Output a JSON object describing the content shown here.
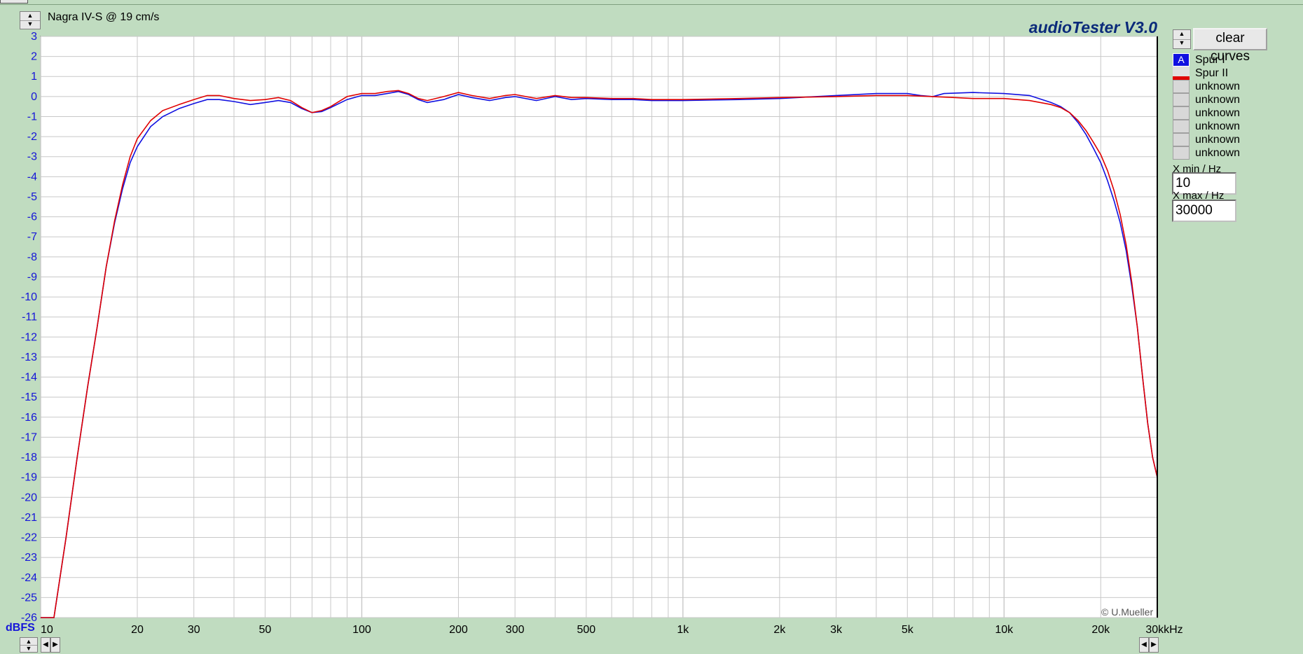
{
  "window": {
    "app_title": "audioTester  V3.0",
    "chart_title": "Nagra IV-S @ 19 cm/s"
  },
  "controls": {
    "clear_label": "clear curves",
    "spin_up": "▲",
    "spin_down": "▼",
    "scroll_left": "◀",
    "scroll_right": "▶"
  },
  "legend": [
    {
      "marker": "A",
      "label": "Spur I",
      "color": "#1010e0"
    },
    {
      "marker": "",
      "label": "Spur II",
      "color": "#e00000"
    },
    {
      "marker": "",
      "label": "unknown"
    },
    {
      "marker": "",
      "label": "unknown"
    },
    {
      "marker": "",
      "label": "unknown"
    },
    {
      "marker": "",
      "label": "unknown"
    },
    {
      "marker": "",
      "label": "unknown"
    },
    {
      "marker": "",
      "label": "unknown"
    }
  ],
  "axis_fields": {
    "xmin_label": "X min / Hz",
    "xmin_value": "10",
    "xmax_label": "X max / Hz",
    "xmax_value": "30000"
  },
  "copyright": "© U.Mueller",
  "colors": {
    "background": "#c0dcc0",
    "plot_background": "#ffffff",
    "grid": "#c8c8c8",
    "axis_text": "#1515d8"
  },
  "chart_data": {
    "type": "line",
    "title": "Nagra IV-S @ 19 cm/s",
    "xscale": "log",
    "xlim": [
      10,
      30000
    ],
    "ylim": [
      -26,
      3
    ],
    "ylabel": "dBFS",
    "xunit": "kHz",
    "grid": true,
    "x_ticks": [
      {
        "value": 10,
        "label": "10"
      },
      {
        "value": 20,
        "label": "20"
      },
      {
        "value": 30,
        "label": "30"
      },
      {
        "value": 50,
        "label": "50"
      },
      {
        "value": 100,
        "label": "100"
      },
      {
        "value": 200,
        "label": "200"
      },
      {
        "value": 300,
        "label": "300"
      },
      {
        "value": 500,
        "label": "500"
      },
      {
        "value": 1000,
        "label": "1k"
      },
      {
        "value": 2000,
        "label": "2k"
      },
      {
        "value": 3000,
        "label": "3k"
      },
      {
        "value": 5000,
        "label": "5k"
      },
      {
        "value": 10000,
        "label": "10k"
      },
      {
        "value": 20000,
        "label": "20k"
      },
      {
        "value": 30000,
        "label": "30k"
      }
    ],
    "y_ticks": [
      3,
      2,
      1,
      0,
      -1,
      -2,
      -3,
      -4,
      -5,
      -6,
      -7,
      -8,
      -9,
      -10,
      -11,
      -12,
      -13,
      -14,
      -15,
      -16,
      -17,
      -18,
      -19,
      -20,
      -21,
      -22,
      -23,
      -24,
      -25,
      -26
    ],
    "series": [
      {
        "name": "Spur I",
        "color": "#1010e0",
        "points": [
          [
            10,
            -26
          ],
          [
            11,
            -26
          ],
          [
            12,
            -22
          ],
          [
            13,
            -18
          ],
          [
            14,
            -14.5
          ],
          [
            15,
            -11.5
          ],
          [
            16,
            -8.5
          ],
          [
            17,
            -6.3
          ],
          [
            18,
            -4.6
          ],
          [
            19,
            -3.3
          ],
          [
            20,
            -2.5
          ],
          [
            22,
            -1.5
          ],
          [
            24,
            -1.0
          ],
          [
            27,
            -0.6
          ],
          [
            30,
            -0.35
          ],
          [
            33,
            -0.15
          ],
          [
            36,
            -0.15
          ],
          [
            40,
            -0.25
          ],
          [
            45,
            -0.4
          ],
          [
            50,
            -0.3
          ],
          [
            55,
            -0.2
          ],
          [
            60,
            -0.3
          ],
          [
            65,
            -0.6
          ],
          [
            70,
            -0.8
          ],
          [
            75,
            -0.75
          ],
          [
            80,
            -0.55
          ],
          [
            90,
            -0.15
          ],
          [
            100,
            0.05
          ],
          [
            110,
            0.05
          ],
          [
            120,
            0.15
          ],
          [
            130,
            0.25
          ],
          [
            140,
            0.1
          ],
          [
            150,
            -0.15
          ],
          [
            160,
            -0.3
          ],
          [
            180,
            -0.15
          ],
          [
            200,
            0.1
          ],
          [
            220,
            -0.05
          ],
          [
            250,
            -0.2
          ],
          [
            280,
            -0.05
          ],
          [
            300,
            0.0
          ],
          [
            350,
            -0.2
          ],
          [
            400,
            0.0
          ],
          [
            450,
            -0.15
          ],
          [
            500,
            -0.1
          ],
          [
            600,
            -0.15
          ],
          [
            700,
            -0.15
          ],
          [
            800,
            -0.2
          ],
          [
            1000,
            -0.2
          ],
          [
            1500,
            -0.15
          ],
          [
            2000,
            -0.1
          ],
          [
            3000,
            0.05
          ],
          [
            4000,
            0.15
          ],
          [
            5000,
            0.15
          ],
          [
            5500,
            0.05
          ],
          [
            6000,
            0.0
          ],
          [
            6500,
            0.15
          ],
          [
            8000,
            0.2
          ],
          [
            10000,
            0.15
          ],
          [
            12000,
            0.05
          ],
          [
            14000,
            -0.3
          ],
          [
            15000,
            -0.5
          ],
          [
            16000,
            -0.8
          ],
          [
            17000,
            -1.3
          ],
          [
            18000,
            -1.9
          ],
          [
            19000,
            -2.6
          ],
          [
            20000,
            -3.3
          ],
          [
            21000,
            -4.2
          ],
          [
            22000,
            -5.2
          ],
          [
            23000,
            -6.3
          ],
          [
            24000,
            -7.7
          ],
          [
            25000,
            -9.5
          ],
          [
            26000,
            -11.5
          ],
          [
            27000,
            -14.0
          ],
          [
            28000,
            -16.3
          ],
          [
            29000,
            -18.0
          ],
          [
            30000,
            -19.0
          ]
        ]
      },
      {
        "name": "Spur II",
        "color": "#e00000",
        "points": [
          [
            10,
            -26
          ],
          [
            11,
            -26
          ],
          [
            12,
            -22
          ],
          [
            13,
            -18
          ],
          [
            14,
            -14.5
          ],
          [
            15,
            -11.5
          ],
          [
            16,
            -8.5
          ],
          [
            17,
            -6.2
          ],
          [
            18,
            -4.4
          ],
          [
            19,
            -3.0
          ],
          [
            20,
            -2.1
          ],
          [
            22,
            -1.2
          ],
          [
            24,
            -0.7
          ],
          [
            27,
            -0.4
          ],
          [
            30,
            -0.15
          ],
          [
            33,
            0.05
          ],
          [
            36,
            0.05
          ],
          [
            40,
            -0.1
          ],
          [
            45,
            -0.2
          ],
          [
            50,
            -0.15
          ],
          [
            55,
            -0.05
          ],
          [
            60,
            -0.2
          ],
          [
            65,
            -0.55
          ],
          [
            70,
            -0.8
          ],
          [
            75,
            -0.7
          ],
          [
            80,
            -0.5
          ],
          [
            90,
            0.0
          ],
          [
            100,
            0.15
          ],
          [
            110,
            0.15
          ],
          [
            120,
            0.25
          ],
          [
            130,
            0.3
          ],
          [
            140,
            0.15
          ],
          [
            150,
            -0.1
          ],
          [
            160,
            -0.2
          ],
          [
            180,
            0.0
          ],
          [
            200,
            0.2
          ],
          [
            220,
            0.05
          ],
          [
            250,
            -0.1
          ],
          [
            280,
            0.05
          ],
          [
            300,
            0.1
          ],
          [
            350,
            -0.1
          ],
          [
            400,
            0.05
          ],
          [
            450,
            -0.05
          ],
          [
            500,
            -0.05
          ],
          [
            600,
            -0.1
          ],
          [
            700,
            -0.1
          ],
          [
            800,
            -0.15
          ],
          [
            1000,
            -0.15
          ],
          [
            1500,
            -0.1
          ],
          [
            2000,
            -0.05
          ],
          [
            3000,
            0.0
          ],
          [
            4000,
            0.05
          ],
          [
            5000,
            0.05
          ],
          [
            6000,
            0.0
          ],
          [
            7000,
            -0.05
          ],
          [
            8000,
            -0.1
          ],
          [
            10000,
            -0.1
          ],
          [
            12000,
            -0.2
          ],
          [
            14000,
            -0.4
          ],
          [
            15000,
            -0.55
          ],
          [
            16000,
            -0.8
          ],
          [
            17000,
            -1.2
          ],
          [
            18000,
            -1.7
          ],
          [
            19000,
            -2.3
          ],
          [
            20000,
            -2.9
          ],
          [
            21000,
            -3.7
          ],
          [
            22000,
            -4.7
          ],
          [
            23000,
            -5.9
          ],
          [
            24000,
            -7.4
          ],
          [
            25000,
            -9.3
          ],
          [
            26000,
            -11.5
          ],
          [
            27000,
            -14.0
          ],
          [
            28000,
            -16.3
          ],
          [
            29000,
            -18.0
          ],
          [
            30000,
            -19.0
          ]
        ]
      }
    ]
  }
}
